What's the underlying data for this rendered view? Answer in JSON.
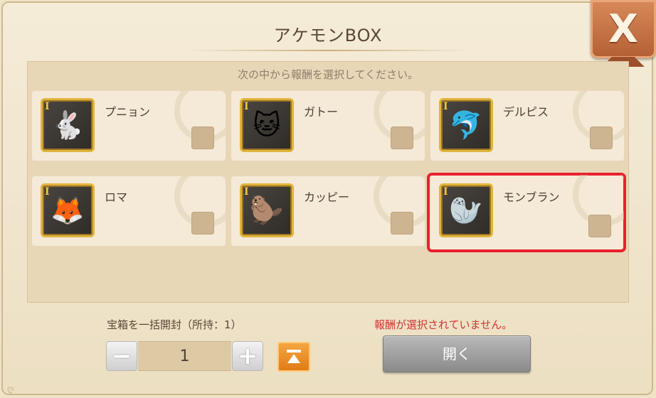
{
  "window": {
    "title": "アケモンBOX",
    "close_label": "X"
  },
  "instruction": "次の中から報酬を選択してください。",
  "rewards": [
    {
      "name": "プニョン",
      "rank": "I",
      "icon": "cloud-creature-icon",
      "art": "🐇",
      "selected": false
    },
    {
      "name": "ガトー",
      "rank": "I",
      "icon": "cake-cat-icon",
      "art": "🐱",
      "selected": false
    },
    {
      "name": "デルピス",
      "rank": "I",
      "icon": "dolphin-creature-icon",
      "art": "🐬",
      "selected": false
    },
    {
      "name": "ロマ",
      "rank": "I",
      "icon": "fox-creature-icon",
      "art": "🦊",
      "selected": false
    },
    {
      "name": "カッピー",
      "rank": "I",
      "icon": "capybara-creature-icon",
      "art": "🦫",
      "selected": false
    },
    {
      "name": "モンブラン",
      "rank": "I",
      "icon": "seal-creature-icon",
      "art": "🦭",
      "selected": true
    }
  ],
  "bulk": {
    "label": "宝箱を一括開封（所持：1）",
    "quantity": "1"
  },
  "warning": "報酬が選択されていません。",
  "open_button_label": "開く",
  "colors": {
    "accent_orange": "#e07a14",
    "selection_red": "#e8212d",
    "warning_red": "#d0342f",
    "close_brown": "#b35f34"
  }
}
